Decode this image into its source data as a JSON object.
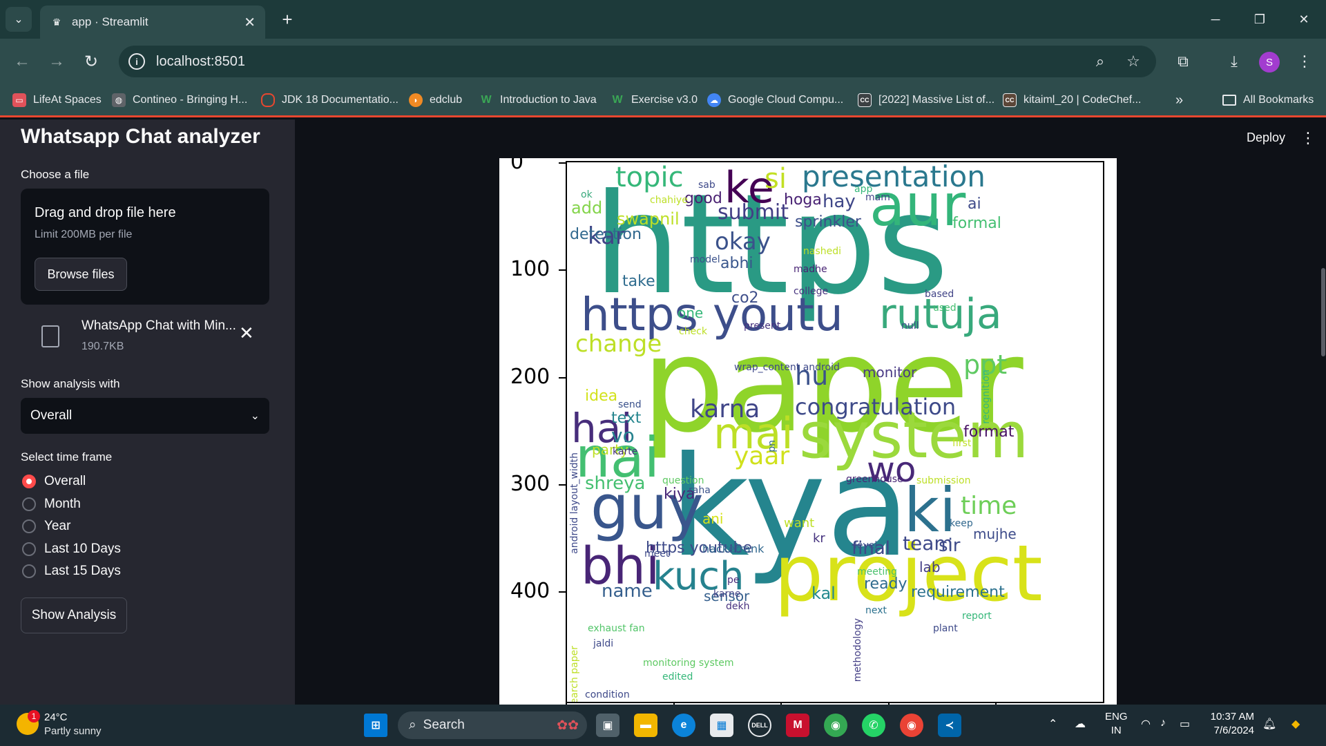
{
  "browser": {
    "tab_title": "app · Streamlit",
    "url": "localhost:8501",
    "bookmarks": [
      {
        "label": "LifeAt Spaces",
        "icon": "lifeat-icon",
        "color": "#e0525a"
      },
      {
        "label": "Contineo - Bringing H...",
        "icon": "globe-icon",
        "color": "#5f6368"
      },
      {
        "label": "JDK 18 Documentatio...",
        "icon": "oracle-icon",
        "color": "#e8472f"
      },
      {
        "label": "edclub",
        "icon": "edclub-icon",
        "color": "#f08a24"
      },
      {
        "label": "Introduction to Java",
        "icon": "w-icon",
        "color": "#3aa655"
      },
      {
        "label": "Exercise v3.0",
        "icon": "w-icon",
        "color": "#3aa655"
      },
      {
        "label": "Google Cloud Compu...",
        "icon": "google-cloud-icon",
        "color": "#4285f4"
      },
      {
        "label": "[2022] Massive List of...",
        "icon": "cc-icon",
        "color": "#3c4043"
      },
      {
        "label": "kitaiml_20 | CodeChef...",
        "icon": "codechef-icon",
        "color": "#5b4638"
      }
    ],
    "all_bookmarks": "All Bookmarks"
  },
  "sidebar": {
    "title": "Whatsapp Chat analyzer",
    "file_label": "Choose a file",
    "drag_text": "Drag and drop file here",
    "limit_text": "Limit 200MB per file",
    "browse_label": "Browse files",
    "file_name": "WhatsApp Chat with Min...",
    "file_size": "190.7KB",
    "analysis_label": "Show analysis with",
    "analysis_value": "Overall",
    "timeframe_label": "Select time frame",
    "timeframes": [
      "Overall",
      "Month",
      "Year",
      "Last 10 Days",
      "Last 15 Days"
    ],
    "selected_timeframe": "Overall",
    "show_button": "Show Analysis"
  },
  "header": {
    "deploy_label": "Deploy"
  },
  "chart_data": {
    "type": "wordcloud",
    "y_ticks": [
      "0",
      "100",
      "200",
      "300",
      "400"
    ],
    "words": [
      "https",
      "paper",
      "kya",
      "system",
      "project",
      "aur",
      "nai",
      "https youtu",
      "rutuja",
      "guy",
      "ki",
      "bhi",
      "ke",
      "presentation",
      "topic",
      "hai",
      "mai",
      "kuch",
      "change",
      "submit",
      "okay",
      "karna",
      "congratulation",
      "wo",
      "yaar",
      "hu",
      "ppt",
      "si",
      "kar",
      "time",
      "shreya",
      "team",
      "final",
      "https youtube",
      "requirement",
      "name",
      "sensor",
      "kal",
      "format",
      "detection",
      "swapnil",
      "hay",
      "hoga",
      "sprinkler",
      "formal",
      "ai",
      "add",
      "good",
      "abhi",
      "co2",
      "take",
      "one",
      "monitor",
      "text",
      "vo",
      "idea",
      "party",
      "kiya",
      "ani",
      "kr",
      "sir",
      "lab",
      "ready",
      "mujhe",
      "want",
      "hackerrank",
      "karne",
      "dekh",
      "pe",
      "meet",
      "exhaust fan",
      "jaldi",
      "monitoring system",
      "edited",
      "condition",
      "plant",
      "next",
      "report",
      "keep",
      "level",
      "meeting",
      "greenhouse",
      "submission",
      "question",
      "raha",
      "karte",
      "send",
      "present",
      "null",
      "used",
      "based",
      "college",
      "madhe",
      "nashedi",
      "app",
      "mam",
      "model",
      "chahiye",
      "ok",
      "sab",
      "check",
      "wrap_content android",
      "android layout_width",
      "research paper",
      "methodology",
      "recognition",
      "first",
      "pn"
    ]
  },
  "taskbar": {
    "temperature": "24°C",
    "weather": "Partly sunny",
    "weather_badge": "1",
    "search": "Search",
    "lang_1": "ENG",
    "lang_2": "IN",
    "time": "10:37 AM",
    "date": "7/6/2024"
  }
}
